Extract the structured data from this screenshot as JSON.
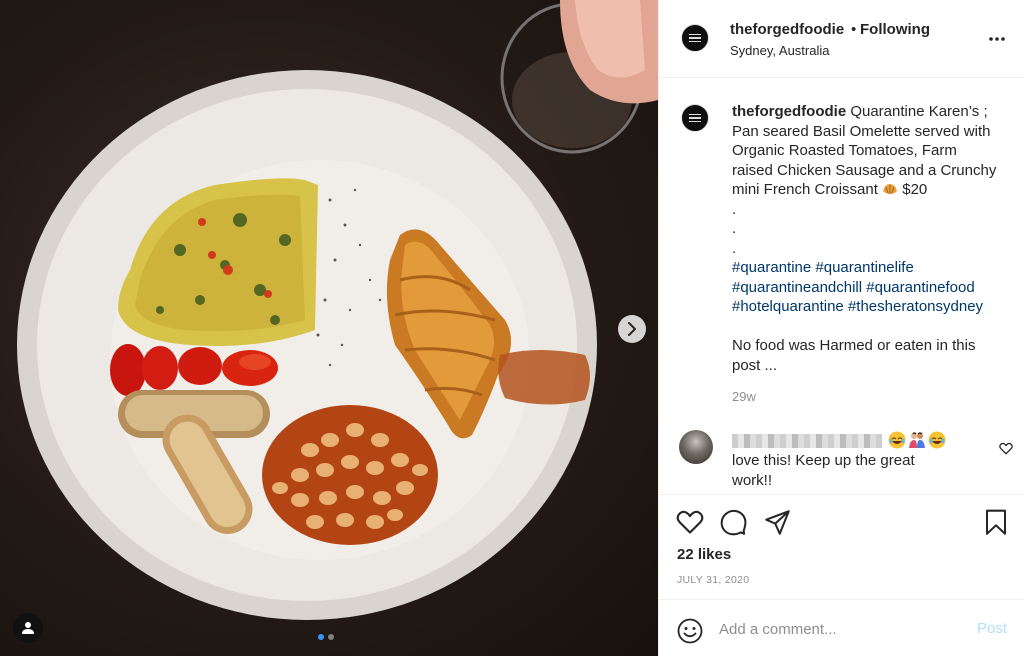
{
  "post": {
    "username": "theforgedfoodie",
    "separator": "•",
    "follow_status": "Following",
    "location": "Sydney, Australia",
    "more_icon": "more-options-icon"
  },
  "caption": {
    "username": "theforgedfoodie",
    "lines": [
      "Quarantine Karen’s ;",
      "Pan seared Basil Omelette served with",
      "Organic Roasted Tomatoes, Farm",
      "raised Chicken Sausage and a Crunchy",
      "mini French Croissant"
    ],
    "price": "$20",
    "dots": [
      ".",
      ".",
      "."
    ],
    "hashtag_lines": [
      [
        "#quarantine",
        "#quarantinelife"
      ],
      [
        "#quarantineandchill",
        "#quarantinefood"
      ],
      [
        "#hotelquarantine",
        "#thesheratonsydney"
      ]
    ],
    "note_lines": [
      "No food was Harmed or eaten in this",
      "post ..."
    ],
    "time": "29w"
  },
  "comment": {
    "text_lines": [
      "love this! Keep up the great",
      "work!!"
    ]
  },
  "actions": {
    "likes": "22 likes",
    "date": "JULY 31, 2020",
    "comment_placeholder": "Add a comment...",
    "post_label": "Post"
  },
  "carousel": {
    "slide_count": 2,
    "active_index": 0
  },
  "colors": {
    "hashtag": "#00376b",
    "post_disabled": "#b2dffc",
    "carousel_active": "#3897f0"
  }
}
